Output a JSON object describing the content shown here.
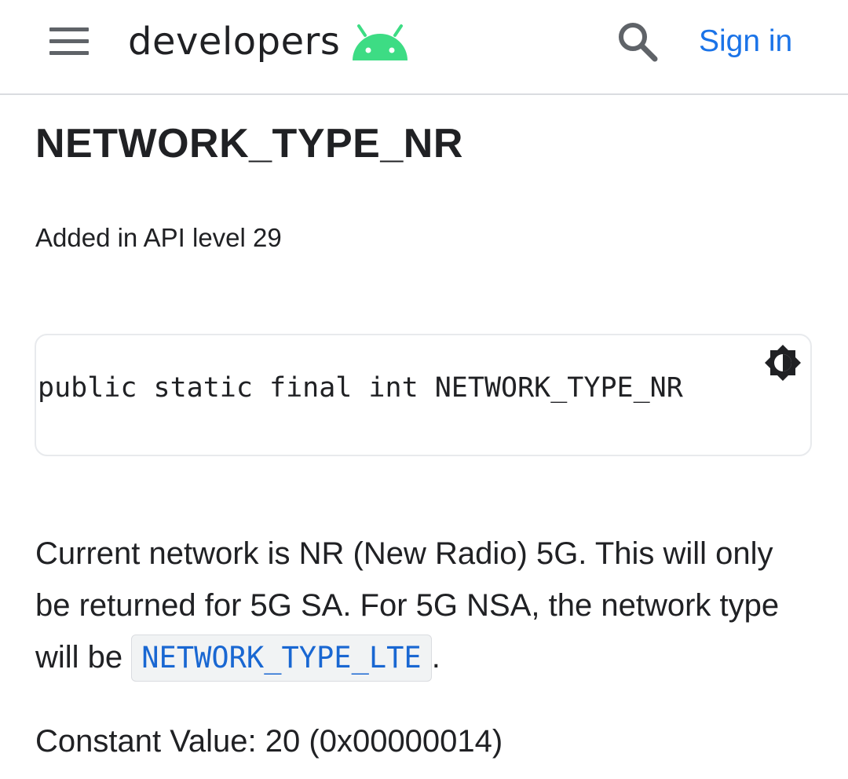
{
  "header": {
    "menu_icon": "hamburger-menu-icon",
    "logo_text": "developers",
    "logo_icon": "android-head-icon",
    "search_icon": "search-icon",
    "signin_label": "Sign in",
    "colors": {
      "android_green": "#3ddc84",
      "link_blue": "#1a73e8"
    }
  },
  "main": {
    "title": "NETWORK_TYPE_NR",
    "api_level": "Added in API level 29",
    "code": {
      "text": "public static final int NETWORK_TYPE_NR",
      "theme_toggle_icon": "brightness-contrast-icon"
    },
    "description": {
      "text": "Current network is NR (New Radio) 5G. This will only be returned for 5G SA. For 5G NSA, the network type will be ",
      "link": "NETWORK_TYPE_LTE",
      "suffix": "."
    },
    "constant": "Constant Value: 20 (0x00000014)"
  }
}
